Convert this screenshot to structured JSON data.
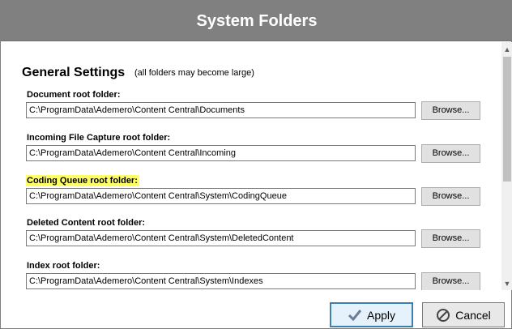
{
  "window": {
    "title": "System Folders"
  },
  "section": {
    "title": "General Settings",
    "note": "(all folders may become large)"
  },
  "fields": [
    {
      "label": "Document root folder:",
      "value": "C:\\ProgramData\\Ademero\\Content Central\\Documents",
      "browse_label": "Browse...",
      "highlighted": false
    },
    {
      "label": "Incoming File Capture root folder:",
      "value": "C:\\ProgramData\\Ademero\\Content Central\\Incoming",
      "browse_label": "Browse...",
      "highlighted": false
    },
    {
      "label": "Coding Queue root folder:",
      "value": "C:\\ProgramData\\Ademero\\Content Central\\System\\CodingQueue",
      "browse_label": "Browse...",
      "highlighted": true
    },
    {
      "label": "Deleted Content root folder:",
      "value": "C:\\ProgramData\\Ademero\\Content Central\\System\\DeletedContent",
      "browse_label": "Browse...",
      "highlighted": false
    },
    {
      "label": "Index root folder:",
      "value": "C:\\ProgramData\\Ademero\\Content Central\\System\\Indexes",
      "browse_label": "Browse...",
      "highlighted": false
    }
  ],
  "footer": {
    "apply_label": "Apply",
    "cancel_label": "Cancel"
  },
  "colors": {
    "titlebar": "#808080",
    "highlight": "#ffff66",
    "apply_border": "#3c7fb1"
  },
  "icons": {
    "apply": "checkmark-icon",
    "cancel": "cancel-circle-icon"
  }
}
